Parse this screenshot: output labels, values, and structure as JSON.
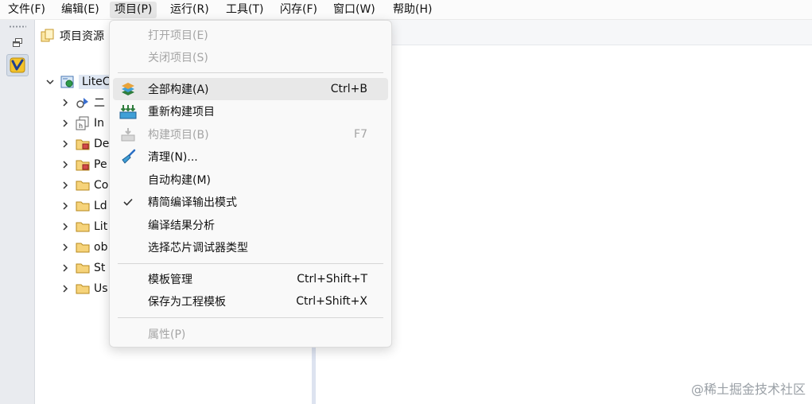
{
  "menubar": {
    "items": [
      {
        "label": "文件(F)"
      },
      {
        "label": "编辑(E)"
      },
      {
        "label": "项目(P)"
      },
      {
        "label": "运行(R)"
      },
      {
        "label": "工具(T)"
      },
      {
        "label": "闪存(F)"
      },
      {
        "label": "窗口(W)"
      },
      {
        "label": "帮助(H)"
      }
    ],
    "active_index": 2
  },
  "explorer": {
    "title": "项目资源",
    "tree": [
      {
        "label": "LiteC",
        "icon": "project-icon",
        "expanded": true
      },
      {
        "label": "二",
        "icon": "binaries-icon"
      },
      {
        "label": "In",
        "icon": "includes-icon"
      },
      {
        "label": "De",
        "icon": "package-folder-icon"
      },
      {
        "label": "Pe",
        "icon": "package-folder-icon"
      },
      {
        "label": "Co",
        "icon": "folder-icon"
      },
      {
        "label": "Ld",
        "icon": "folder-icon"
      },
      {
        "label": "Lit",
        "icon": "folder-icon"
      },
      {
        "label": "ob",
        "icon": "folder-icon"
      },
      {
        "label": "St",
        "icon": "folder-icon"
      },
      {
        "label": "Us",
        "icon": "folder-icon"
      }
    ]
  },
  "project_menu": {
    "items": [
      {
        "label": "打开项目(E)",
        "shortcut": "",
        "disabled": true,
        "icon": ""
      },
      {
        "label": "关闭项目(S)",
        "shortcut": "",
        "disabled": true,
        "icon": ""
      },
      {
        "label": "全部构建(A)",
        "shortcut": "Ctrl+B",
        "disabled": false,
        "icon": "build-all-icon",
        "hover": true
      },
      {
        "label": "重新构建项目",
        "shortcut": "",
        "disabled": false,
        "icon": "rebuild-icon"
      },
      {
        "label": "构建项目(B)",
        "shortcut": "F7",
        "disabled": true,
        "icon": "build-project-icon"
      },
      {
        "label": "清理(N)...",
        "shortcut": "",
        "disabled": false,
        "icon": "clean-broom-icon"
      },
      {
        "label": "自动构建(M)",
        "shortcut": "",
        "disabled": false,
        "icon": ""
      },
      {
        "label": "精简编译输出模式",
        "shortcut": "",
        "disabled": false,
        "icon": "check-icon",
        "checked": true
      },
      {
        "label": "编译结果分析",
        "shortcut": "",
        "disabled": false,
        "icon": ""
      },
      {
        "label": "选择芯片调试器类型",
        "shortcut": "",
        "disabled": false,
        "icon": ""
      },
      {
        "label": "模板管理",
        "shortcut": "Ctrl+Shift+T",
        "disabled": false,
        "icon": ""
      },
      {
        "label": "保存为工程模板",
        "shortcut": "Ctrl+Shift+X",
        "disabled": false,
        "icon": ""
      },
      {
        "label": "属性(P)",
        "shortcut": "",
        "disabled": true,
        "icon": ""
      }
    ]
  },
  "watermark": {
    "text": "@稀土掘金技术社区"
  },
  "colors": {
    "menu_background": "#f9f9f9",
    "hover_background": "#e8e8e8",
    "disabled_text": "#a5a5a5",
    "tree_selection": "#dfe7f3"
  }
}
